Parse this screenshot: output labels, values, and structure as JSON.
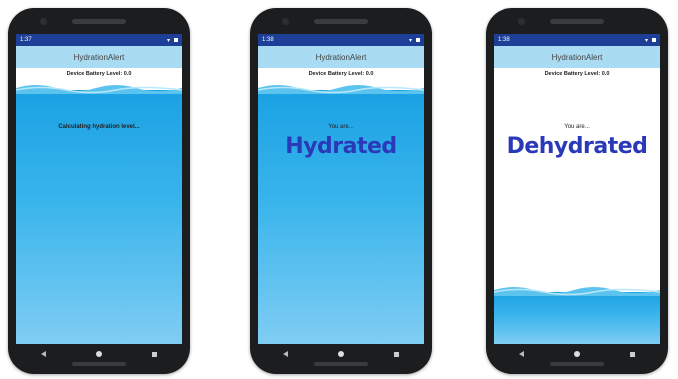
{
  "phones": [
    {
      "status": {
        "time": "1:37",
        "icons_left": [
          "G",
          "▣",
          "▤"
        ]
      },
      "title": "HydrationAlert",
      "battery": "Device Battery Level: 0.0",
      "message": "Calculating hydration level...",
      "water_level": 0.9
    },
    {
      "status": {
        "time": "1:38",
        "icons_left": [
          "G",
          "✕",
          "▤"
        ]
      },
      "title": "HydrationAlert",
      "battery": "Device Battery Level: 0.0",
      "you_are": "You are...",
      "result": "Hydrated",
      "water_level": 0.9
    },
    {
      "status": {
        "time": "1:38",
        "icons_left": [
          "G",
          "✕",
          "▤"
        ]
      },
      "title": "HydrationAlert",
      "battery": "Device Battery Level: 0.0",
      "you_are": "You are...",
      "result": "Dehydrated",
      "water_level": 0.15
    }
  ],
  "colors": {
    "status_bar": "#1d3f97",
    "title_bar": "#a9dcf3",
    "water": "#1aa1e3",
    "result_text": "#2a39b8"
  }
}
